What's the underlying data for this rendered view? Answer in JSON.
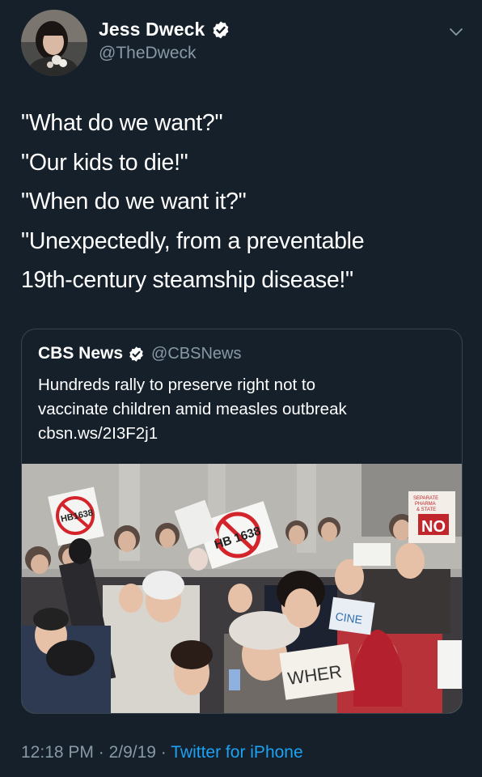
{
  "author": {
    "display_name": "Jess Dweck",
    "handle": "@TheDweck"
  },
  "tweet": {
    "lines": [
      "\"What do we want?\"",
      "\"Our kids to die!\"",
      "\"When do we want it?\"",
      "\"Unexpectedly, from a preventable",
      "19th-century steamship disease!\""
    ]
  },
  "quoted_tweet": {
    "display_name": "CBS News",
    "handle": "@CBSNews",
    "text_lines": [
      "Hundreds rally to preserve right not to",
      "vaccinate children amid measles outbreak",
      "cbsn.ws/2I3F2j1"
    ],
    "image": {
      "sign_texts": [
        "HB 1638",
        "HB 1638",
        "WHER",
        "CINE",
        "NO",
        "SEPARATE PHARMA & STATE"
      ]
    }
  },
  "footer": {
    "time": "12:18 PM",
    "sep1": " · ",
    "date": "2/9/19",
    "sep2": " · ",
    "source": "Twitter for iPhone"
  },
  "colors": {
    "background": "#15202b",
    "secondary_text": "#8899a6",
    "accent": "#1da1f2",
    "border": "#38444d"
  }
}
